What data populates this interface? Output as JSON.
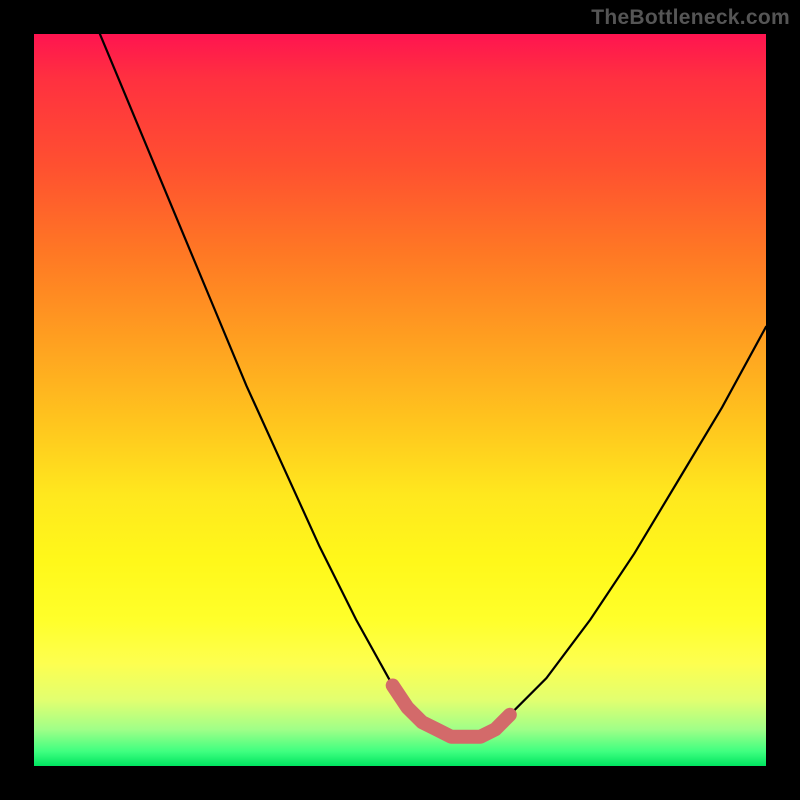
{
  "watermark": "TheBottleneck.com",
  "chart_data": {
    "type": "line",
    "title": "",
    "xlabel": "",
    "ylabel": "",
    "xlim": [
      0,
      100
    ],
    "ylim": [
      0,
      100
    ],
    "series": [
      {
        "name": "bottleneck-curve",
        "x": [
          9,
          14,
          19,
          24,
          29,
          34,
          39,
          44,
          49,
          51,
          53,
          55,
          57,
          59,
          61,
          63,
          65,
          70,
          76,
          82,
          88,
          94,
          100
        ],
        "values": [
          100,
          88,
          76,
          64,
          52,
          41,
          30,
          20,
          11,
          8,
          6,
          5,
          4,
          4,
          4,
          5,
          7,
          12,
          20,
          29,
          39,
          49,
          60
        ]
      }
    ],
    "flat_segment": {
      "x": [
        49,
        51,
        53,
        55,
        57,
        59,
        61,
        63,
        65
      ],
      "values": [
        11,
        8,
        6,
        5,
        4,
        4,
        4,
        5,
        7
      ],
      "color": "#d36a6a"
    },
    "gradient_stops": [
      {
        "pos": 0,
        "color": "#ff1450"
      },
      {
        "pos": 18,
        "color": "#ff5030"
      },
      {
        "pos": 42,
        "color": "#ffa020"
      },
      {
        "pos": 63,
        "color": "#ffe81e"
      },
      {
        "pos": 86,
        "color": "#fdff50"
      },
      {
        "pos": 100,
        "color": "#00e560"
      }
    ]
  }
}
